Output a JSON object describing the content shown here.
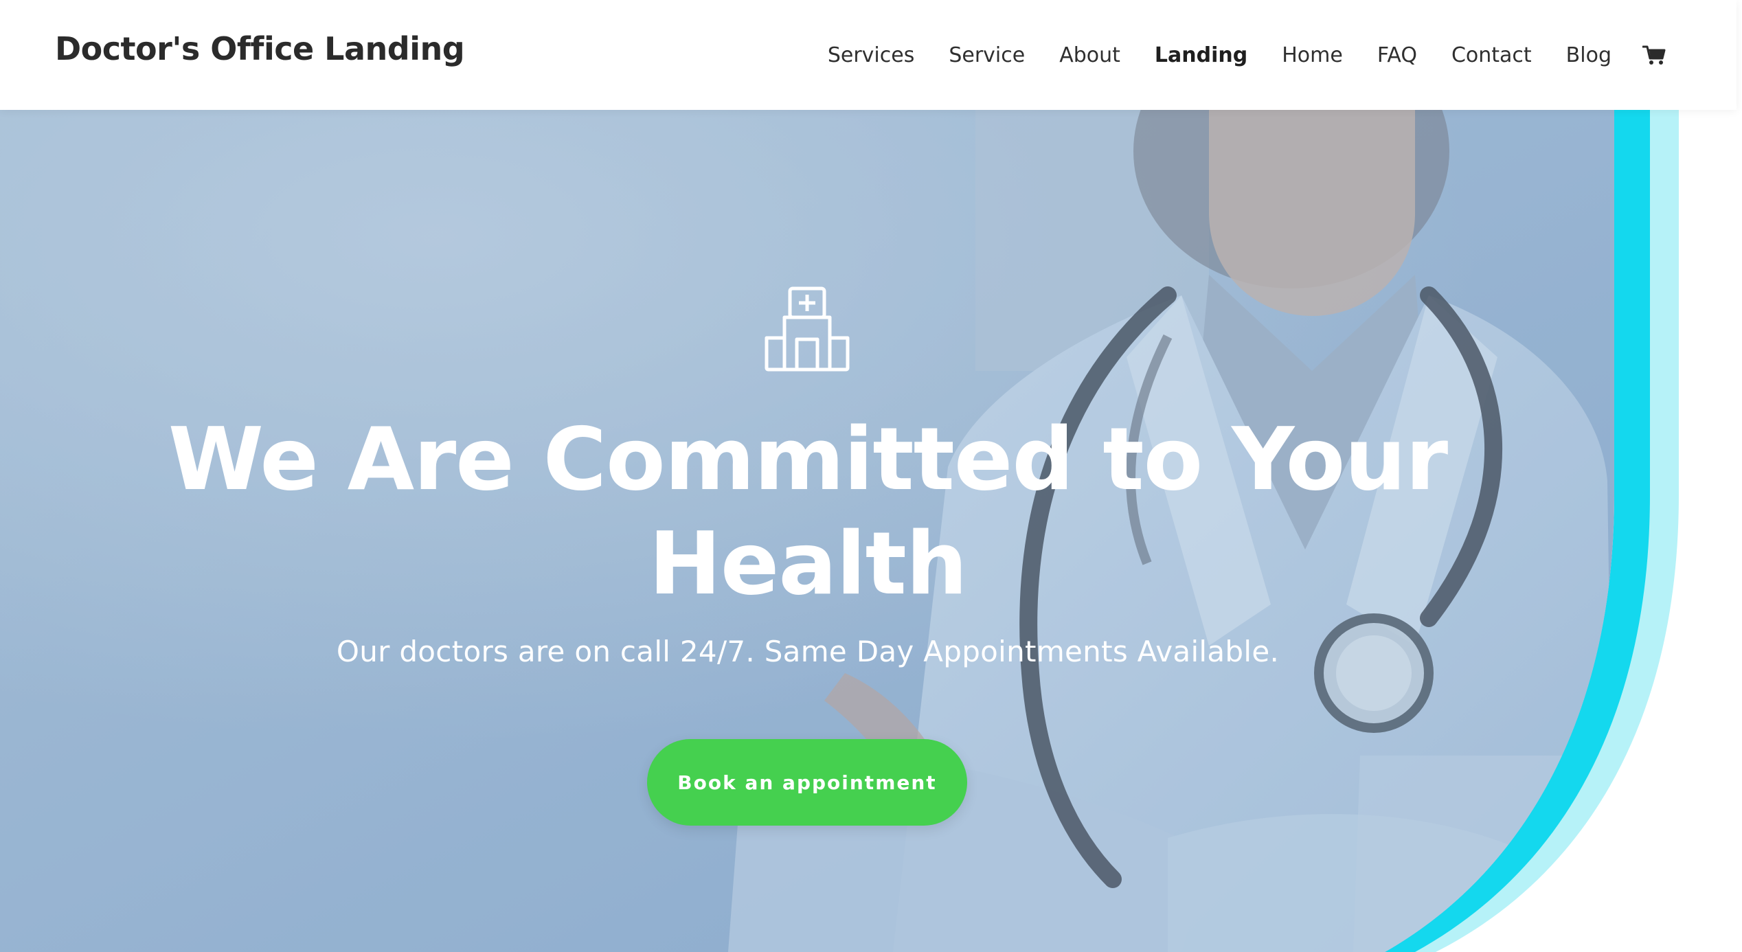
{
  "header": {
    "site_title": "Doctor's Office Landing",
    "nav": [
      {
        "label": "Services"
      },
      {
        "label": "Service"
      },
      {
        "label": "About"
      },
      {
        "label": "Landing",
        "current": true
      },
      {
        "label": "Home"
      },
      {
        "label": "FAQ"
      },
      {
        "label": "Contact"
      },
      {
        "label": "Blog"
      }
    ],
    "cart_icon": "shopping-cart-icon"
  },
  "hero": {
    "icon": "hospital-building-icon",
    "title": "We Are Committed to Your Health",
    "subtitle": "Our doctors are on call 24/7. Same Day Appointments Available.",
    "cta_label": "Book an appointment",
    "background_image": "doctor-with-stethoscope-photo"
  },
  "colors": {
    "cta_green": "#45d04f",
    "accent_cyan": "#14d8ee",
    "accent_light_cyan": "#b6f2f8",
    "hero_overlay": "#8fb0d0",
    "text_dark": "#2b2b2b"
  }
}
